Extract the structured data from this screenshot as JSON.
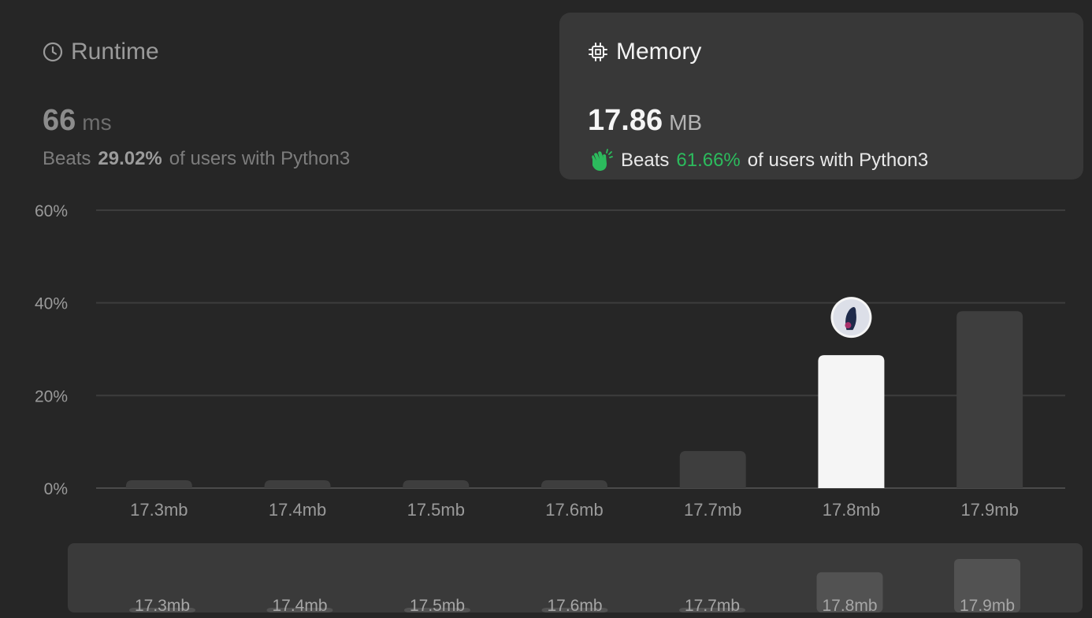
{
  "runtime": {
    "title": "Runtime",
    "icon": "clock-icon",
    "value": "66",
    "unit": "ms",
    "beats_prefix": "Beats",
    "beats_pct": "29.02%",
    "beats_suffix": "of users with Python3"
  },
  "memory": {
    "title": "Memory",
    "icon": "chip-icon",
    "value": "17.86",
    "unit": "MB",
    "beats_icon": "clap-icon",
    "beats_prefix": "Beats",
    "beats_pct": "61.66%",
    "beats_suffix": "of users with Python3",
    "accent": "#2cbb5d"
  },
  "chart_data": {
    "type": "bar",
    "categories": [
      "17.3mb",
      "17.4mb",
      "17.5mb",
      "17.6mb",
      "17.7mb",
      "17.8mb",
      "17.9mb"
    ],
    "values": [
      1.5,
      1.5,
      1.5,
      1.5,
      8.0,
      28.7,
      38.2
    ],
    "highlight_index": 5,
    "y_ticks": [
      "0%",
      "20%",
      "40%",
      "60%"
    ],
    "ylim": [
      0,
      60
    ],
    "grid": true,
    "colors": {
      "bar": "#3e3e3e",
      "highlight": "#f5f5f5",
      "grid": "#3d3d3d",
      "tick": "#9a9a9a"
    }
  },
  "mini_chart": {
    "categories": [
      "17.3mb",
      "17.4mb",
      "17.5mb",
      "17.6mb",
      "17.7mb",
      "17.8mb",
      "17.9mb"
    ],
    "values": [
      1.5,
      1.5,
      1.5,
      1.5,
      8.0,
      28.7,
      38.2
    ]
  }
}
